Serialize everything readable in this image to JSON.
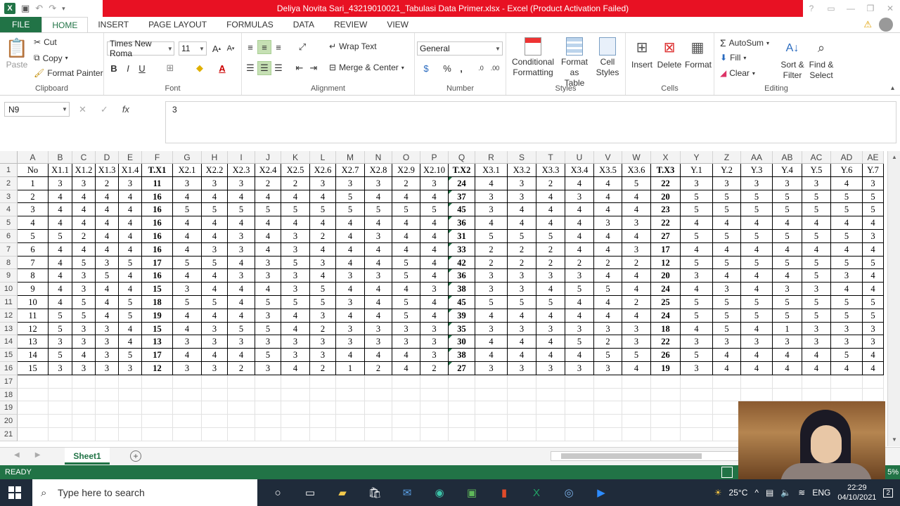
{
  "window": {
    "title": "Deliya Novita Sari_43219010021_Tabulasi Data Primer.xlsx -  Excel (Product Activation Failed)"
  },
  "tabs": [
    {
      "label": "FILE"
    },
    {
      "label": "HOME"
    },
    {
      "label": "INSERT"
    },
    {
      "label": "PAGE LAYOUT"
    },
    {
      "label": "FORMULAS"
    },
    {
      "label": "DATA"
    },
    {
      "label": "REVIEW"
    },
    {
      "label": "VIEW"
    }
  ],
  "ribbon": {
    "clipboard": {
      "paste": "Paste",
      "cut": "Cut",
      "copy": "Copy",
      "format_painter": "Format Painter",
      "label": "Clipboard"
    },
    "font": {
      "name": "Times New Roma",
      "size": "11",
      "bold": "B",
      "italic": "I",
      "underline": "U",
      "label": "Font"
    },
    "alignment": {
      "wrap_text": "Wrap Text",
      "merge_center": "Merge & Center",
      "label": "Alignment"
    },
    "number": {
      "format": "General",
      "percent": "%",
      "comma": ",",
      "label": "Number"
    },
    "styles": {
      "conditional_1": "Conditional",
      "conditional_2": "Formatting",
      "format_table_1": "Format as",
      "format_table_2": "Table",
      "cell_styles_1": "Cell",
      "cell_styles_2": "Styles",
      "label": "Styles"
    },
    "cells": {
      "insert": "Insert",
      "delete": "Delete",
      "format": "Format",
      "label": "Cells"
    },
    "editing": {
      "autosum": "AutoSum",
      "fill": "Fill",
      "clear": "Clear",
      "sort_1": "Sort &",
      "sort_2": "Filter",
      "find_1": "Find &",
      "find_2": "Select",
      "label": "Editing"
    }
  },
  "formula_bar": {
    "name_box": "N9",
    "fx": "fx",
    "value": "3"
  },
  "sheet": {
    "columns": [
      "A",
      "B",
      "C",
      "D",
      "E",
      "F",
      "G",
      "H",
      "I",
      "J",
      "K",
      "L",
      "M",
      "N",
      "O",
      "P",
      "Q",
      "R",
      "S",
      "T",
      "U",
      "V",
      "W",
      "X",
      "Y",
      "Z",
      "AA",
      "AB",
      "AC",
      "AD",
      "AE"
    ],
    "row_numbers": [
      "1",
      "2",
      "3",
      "4",
      "5",
      "6",
      "7",
      "8",
      "9",
      "10",
      "11",
      "12",
      "13",
      "14",
      "15",
      "16",
      "17",
      "18",
      "19",
      "20",
      "21"
    ],
    "header": [
      "No",
      "X1.1",
      "X1.2",
      "X1.3",
      "X1.4",
      "T.X1",
      "X2.1",
      "X2.2",
      "X2.3",
      "X2.4",
      "X2.5",
      "X2.6",
      "X2.7",
      "X2.8",
      "X2.9",
      "X2.10",
      "T.X2",
      "X3.1",
      "X3.2",
      "X3.3",
      "X3.4",
      "X3.5",
      "X3.6",
      "T.X3",
      "Y.1",
      "Y.2",
      "Y.3",
      "Y.4",
      "Y.5",
      "Y.6",
      "Y.7"
    ],
    "rows": [
      [
        "1",
        "3",
        "3",
        "2",
        "3",
        "11",
        "3",
        "3",
        "3",
        "2",
        "2",
        "3",
        "3",
        "3",
        "2",
        "3",
        "24",
        "4",
        "3",
        "2",
        "4",
        "4",
        "5",
        "22",
        "3",
        "3",
        "3",
        "3",
        "3",
        "4",
        "3"
      ],
      [
        "2",
        "4",
        "4",
        "4",
        "4",
        "16",
        "4",
        "4",
        "4",
        "4",
        "4",
        "4",
        "5",
        "4",
        "4",
        "4",
        "37",
        "3",
        "3",
        "4",
        "3",
        "4",
        "4",
        "20",
        "5",
        "5",
        "5",
        "5",
        "5",
        "5",
        "5"
      ],
      [
        "3",
        "4",
        "4",
        "4",
        "4",
        "16",
        "5",
        "5",
        "5",
        "5",
        "5",
        "5",
        "5",
        "5",
        "5",
        "5",
        "45",
        "3",
        "4",
        "4",
        "4",
        "4",
        "4",
        "23",
        "5",
        "5",
        "5",
        "5",
        "5",
        "5",
        "5"
      ],
      [
        "4",
        "4",
        "4",
        "4",
        "4",
        "16",
        "4",
        "4",
        "4",
        "4",
        "4",
        "4",
        "4",
        "4",
        "4",
        "4",
        "36",
        "4",
        "4",
        "4",
        "4",
        "3",
        "3",
        "22",
        "4",
        "4",
        "4",
        "4",
        "4",
        "4",
        "4"
      ],
      [
        "5",
        "5",
        "2",
        "4",
        "4",
        "16",
        "4",
        "4",
        "3",
        "4",
        "3",
        "2",
        "4",
        "3",
        "4",
        "4",
        "31",
        "5",
        "5",
        "5",
        "4",
        "4",
        "4",
        "27",
        "5",
        "5",
        "5",
        "5",
        "5",
        "5",
        "3"
      ],
      [
        "6",
        "4",
        "4",
        "4",
        "4",
        "16",
        "4",
        "3",
        "3",
        "4",
        "3",
        "4",
        "4",
        "4",
        "4",
        "4",
        "33",
        "2",
        "2",
        "2",
        "4",
        "4",
        "3",
        "17",
        "4",
        "4",
        "4",
        "4",
        "4",
        "4",
        "4"
      ],
      [
        "7",
        "4",
        "5",
        "3",
        "5",
        "17",
        "5",
        "5",
        "4",
        "3",
        "5",
        "3",
        "4",
        "4",
        "5",
        "4",
        "42",
        "2",
        "2",
        "2",
        "2",
        "2",
        "2",
        "12",
        "5",
        "5",
        "5",
        "5",
        "5",
        "5",
        "5"
      ],
      [
        "8",
        "4",
        "3",
        "5",
        "4",
        "16",
        "4",
        "4",
        "3",
        "3",
        "3",
        "4",
        "3",
        "3",
        "5",
        "4",
        "36",
        "3",
        "3",
        "3",
        "3",
        "4",
        "4",
        "20",
        "3",
        "4",
        "4",
        "4",
        "5",
        "3",
        "4"
      ],
      [
        "9",
        "4",
        "3",
        "4",
        "4",
        "15",
        "3",
        "4",
        "4",
        "4",
        "3",
        "5",
        "4",
        "4",
        "4",
        "3",
        "38",
        "3",
        "3",
        "4",
        "5",
        "5",
        "4",
        "24",
        "4",
        "3",
        "4",
        "3",
        "3",
        "4",
        "4"
      ],
      [
        "10",
        "4",
        "5",
        "4",
        "5",
        "18",
        "5",
        "5",
        "4",
        "5",
        "5",
        "5",
        "3",
        "4",
        "5",
        "4",
        "45",
        "5",
        "5",
        "5",
        "4",
        "4",
        "2",
        "25",
        "5",
        "5",
        "5",
        "5",
        "5",
        "5",
        "5"
      ],
      [
        "11",
        "5",
        "5",
        "4",
        "5",
        "19",
        "4",
        "4",
        "4",
        "3",
        "4",
        "3",
        "4",
        "4",
        "5",
        "4",
        "39",
        "4",
        "4",
        "4",
        "4",
        "4",
        "4",
        "24",
        "5",
        "5",
        "5",
        "5",
        "5",
        "5",
        "5"
      ],
      [
        "12",
        "5",
        "3",
        "3",
        "4",
        "15",
        "4",
        "3",
        "5",
        "5",
        "4",
        "2",
        "3",
        "3",
        "3",
        "3",
        "35",
        "3",
        "3",
        "3",
        "3",
        "3",
        "3",
        "18",
        "4",
        "5",
        "4",
        "1",
        "3",
        "3",
        "3"
      ],
      [
        "13",
        "3",
        "3",
        "3",
        "4",
        "13",
        "3",
        "3",
        "3",
        "3",
        "3",
        "3",
        "3",
        "3",
        "3",
        "3",
        "30",
        "4",
        "4",
        "4",
        "5",
        "2",
        "3",
        "22",
        "3",
        "3",
        "3",
        "3",
        "3",
        "3",
        "3"
      ],
      [
        "14",
        "5",
        "4",
        "3",
        "5",
        "17",
        "4",
        "4",
        "4",
        "5",
        "3",
        "3",
        "4",
        "4",
        "4",
        "3",
        "38",
        "4",
        "4",
        "4",
        "4",
        "5",
        "5",
        "26",
        "5",
        "4",
        "4",
        "4",
        "4",
        "5",
        "4"
      ],
      [
        "15",
        "3",
        "3",
        "3",
        "3",
        "12",
        "3",
        "3",
        "2",
        "3",
        "4",
        "2",
        "1",
        "2",
        "4",
        "2",
        "27",
        "3",
        "3",
        "3",
        "3",
        "3",
        "4",
        "19",
        "3",
        "4",
        "4",
        "4",
        "4",
        "4",
        "4"
      ]
    ]
  },
  "sheet_tabs": [
    {
      "label": "Sheet1"
    }
  ],
  "status": {
    "ready": "READY",
    "zoom": "5%"
  },
  "taskbar": {
    "search_placeholder": "Type here to search",
    "temperature": "25°C",
    "language": "ENG",
    "time": "22:29",
    "date": "04/10/2021",
    "notifications": "2"
  },
  "colors": {
    "excel_green": "#217346",
    "title_red": "#e81123",
    "taskbar": "#1f2b3a"
  }
}
